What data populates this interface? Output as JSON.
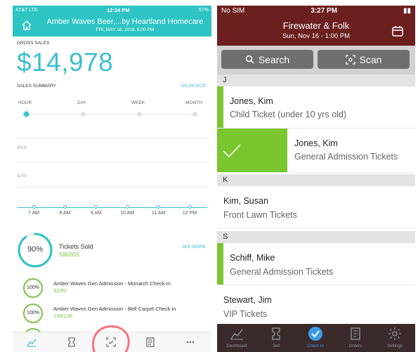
{
  "left_app": {
    "status": {
      "carrier": "AT&T  LTE",
      "time": "12:34 PM",
      "battery": "57%"
    },
    "header": {
      "title": "Amber Waves Beer,...by Heartland Homecare",
      "subtitle": "FRI, MAY 18, 2018, 6:00 PM"
    },
    "gross": {
      "label": "GROSS SALES",
      "value": "$14,978"
    },
    "summary": {
      "label": "SALES SUMMARY",
      "link": "ON DEVICE"
    },
    "periods": [
      {
        "label": "HOUR",
        "active": true
      },
      {
        "label": "DAY",
        "active": false
      },
      {
        "label": "WEEK",
        "active": false
      },
      {
        "label": "MONTH",
        "active": false
      }
    ],
    "chart_data": {
      "type": "line",
      "xlabel": "",
      "ylabel": "",
      "x": [
        "7 AM",
        "8 AM",
        "9 AM",
        "10 AM",
        "11 AM",
        "12 PM"
      ],
      "y_ticks": [
        "$500",
        "$250"
      ],
      "ylim": [
        0,
        600
      ],
      "series": [
        {
          "values": [
            0,
            0,
            0,
            0,
            0,
            0
          ]
        }
      ],
      "grid": true
    },
    "tickets": {
      "percent": "90%",
      "fraction": 0.9,
      "title": "Tickets Sold",
      "count": "588/655",
      "link": "SEE MORE"
    },
    "checkins": [
      {
        "percent": "100%",
        "name": "Amber Waves Gen Admission - Monarch Check-in",
        "count": "92/92"
      },
      {
        "percent": "100%",
        "name": "Amber Waves Gen Admission - Bell Carpet Check in",
        "count": "136/136"
      }
    ],
    "tabs": [
      "chart-icon",
      "ticket-icon",
      "scan-icon",
      "orders-icon",
      "more-icon"
    ],
    "accent": "#2ec4c4",
    "success": "#7cc24a"
  },
  "right_app": {
    "status": {
      "carrier": "No SIM",
      "time": "3:27 PM"
    },
    "header": {
      "title": "Firewater & Folk",
      "subtitle": "Sun, Nov 16 - 1:00 PM"
    },
    "search_label": "Search",
    "scan_label": "Scan",
    "sections": [
      {
        "letter": "J",
        "rows": [
          {
            "name": "Jones, Kim",
            "ticket": "Child Ticket (under 10 yrs old)",
            "checked": true,
            "swiped": false
          },
          {
            "name": "Jones, Kim",
            "ticket": "General Admission Tickets",
            "checked": true,
            "swiped": true
          }
        ]
      },
      {
        "letter": "K",
        "rows": [
          {
            "name": "Kim, Susan",
            "ticket": "Front Lawn Tickets",
            "checked": false,
            "swiped": false
          }
        ]
      },
      {
        "letter": "S",
        "rows": [
          {
            "name": "Schiff, Mike",
            "ticket": "General Admission Tickets",
            "checked": true,
            "swiped": false
          },
          {
            "name": "Stewart, Jim",
            "ticket": "VIP Tickets",
            "checked": false,
            "swiped": false
          }
        ]
      }
    ],
    "tabs": [
      {
        "label": "Dashboard",
        "icon": "chart-icon",
        "active": false
      },
      {
        "label": "Sell",
        "icon": "ticket-icon",
        "active": false
      },
      {
        "label": "Check In",
        "icon": "checkmark-icon",
        "active": true
      },
      {
        "label": "Orders",
        "icon": "orders-icon",
        "active": false
      },
      {
        "label": "Settings",
        "icon": "gear-icon",
        "active": false
      }
    ],
    "header_color": "#6b1f1f",
    "check_color": "#7ac62e"
  }
}
